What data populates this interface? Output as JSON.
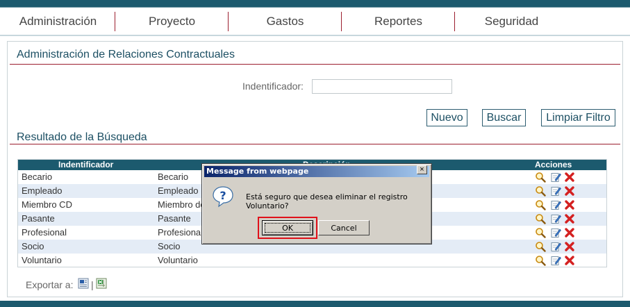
{
  "nav": {
    "items": [
      "Administración",
      "Proyecto",
      "Gastos",
      "Reportes",
      "Seguridad"
    ]
  },
  "panel": {
    "title": "Administración de Relaciones Contractuales",
    "filter_label": "Indentificador:",
    "filter_value": "",
    "buttons": {
      "new": "Nuevo",
      "search": "Buscar",
      "clear": "Limpiar Filtro"
    },
    "results_title": "Resultado de la Búsqueda"
  },
  "grid": {
    "headers": {
      "id": "Indentificador",
      "desc": "Descripción",
      "actions": "Acciones"
    },
    "rows": [
      {
        "id": "Becario",
        "desc": "Becario"
      },
      {
        "id": "Empleado",
        "desc": "Empleado"
      },
      {
        "id": "Miembro CD",
        "desc": "Miembro del CD"
      },
      {
        "id": "Pasante",
        "desc": "Pasante"
      },
      {
        "id": "Profesional",
        "desc": "Profesional"
      },
      {
        "id": "Socio",
        "desc": "Socio"
      },
      {
        "id": "Voluntario",
        "desc": "Voluntario"
      }
    ]
  },
  "export": {
    "label": "Exportar a:",
    "separator": "|"
  },
  "dialog": {
    "title": "Message from webpage",
    "close": "×",
    "message": "Está seguro que desea eliminar el registro Voluntario?",
    "ok": "OK",
    "cancel": "Cancel"
  },
  "colors": {
    "brand": "#1c5a6e",
    "accent": "#9b1e2e",
    "highlight": "#e0101a"
  },
  "icons": [
    "question-icon",
    "view-icon",
    "edit-icon",
    "delete-icon",
    "export-word-icon",
    "export-excel-icon",
    "close-icon"
  ]
}
